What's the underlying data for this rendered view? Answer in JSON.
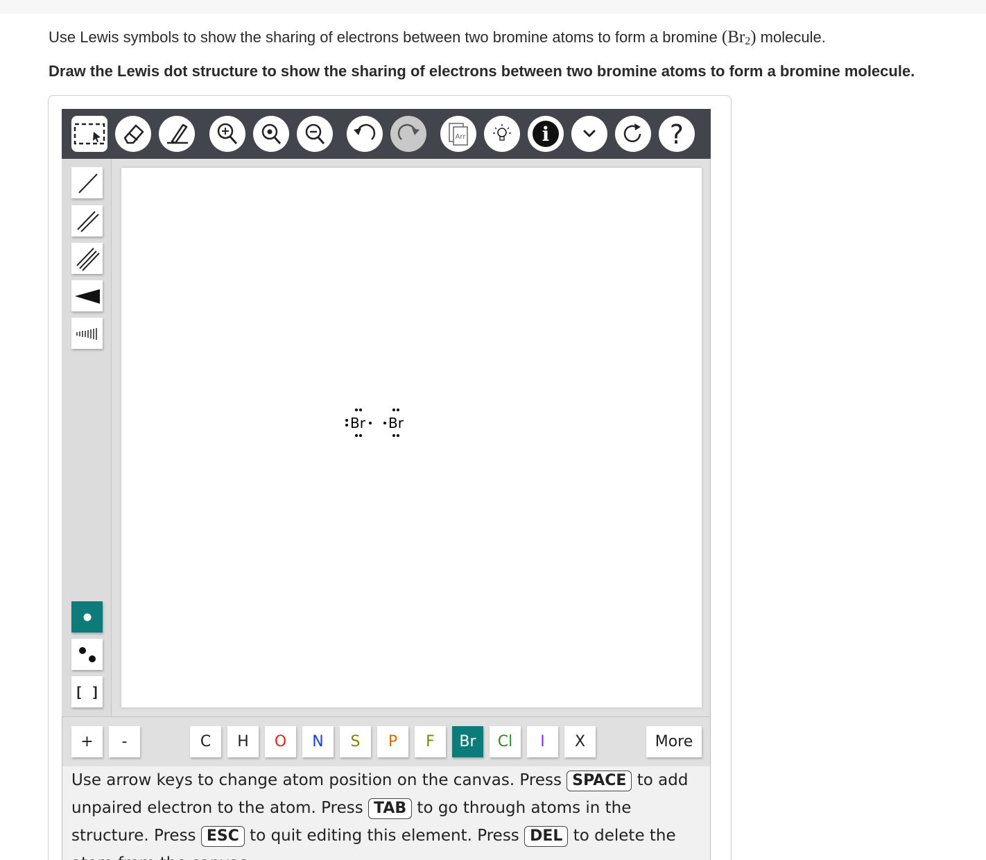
{
  "question": {
    "line1_before": "Use Lewis symbols to show the sharing of electrons between two bromine atoms to form a bromine ",
    "formula_open": "(",
    "formula_element": "Br",
    "formula_subscript": "2",
    "formula_close": ")",
    "line1_after": " molecule.",
    "instruction": "Draw the Lewis dot structure to show the sharing of electrons between two bromine atoms to form a bromine molecule."
  },
  "toolbar": {
    "template_label": "Arr",
    "help_label": "?",
    "info_label": "i"
  },
  "canvas": {
    "atoms": [
      {
        "symbol": "Br"
      },
      {
        "symbol": "Br"
      }
    ]
  },
  "left_tools": {
    "bracket_label": "[ ]"
  },
  "atom_bar": {
    "plus": "+",
    "minus": "-",
    "elements": [
      {
        "label": "C",
        "color": "#222222"
      },
      {
        "label": "H",
        "color": "#222222"
      },
      {
        "label": "O",
        "color": "#e3241b"
      },
      {
        "label": "N",
        "color": "#1b3fe3"
      },
      {
        "label": "S",
        "color": "#8a7d00"
      },
      {
        "label": "P",
        "color": "#d07000"
      },
      {
        "label": "F",
        "color": "#6b8f00"
      },
      {
        "label": "Br",
        "color": "#ffffff",
        "selected": true
      },
      {
        "label": "Cl",
        "color": "#2e8b2e"
      },
      {
        "label": "I",
        "color": "#8a2be2"
      },
      {
        "label": "X",
        "color": "#222222"
      }
    ],
    "more": "More"
  },
  "help": {
    "t1": "Use arrow keys to change atom position on the canvas. Press ",
    "k1": "SPACE",
    "t2": " to add unpaired electron to the atom. Press ",
    "k2": "TAB",
    "t3": " to go through atoms in the structure. Press ",
    "k3": "ESC",
    "t4": " to quit editing this element. Press ",
    "k4": "DEL",
    "t5": " to delete the atom from the canvas."
  }
}
